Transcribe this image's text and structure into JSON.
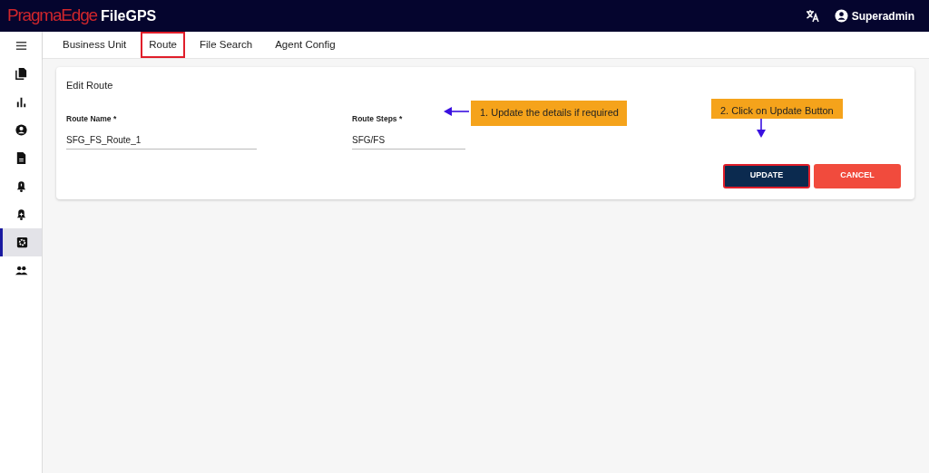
{
  "header": {
    "logo_brand": "PragmaEdge",
    "logo_product": "FileGPS",
    "user": "Superadmin"
  },
  "sidebar": {
    "items": [
      {
        "kind": "menu",
        "selected": false
      },
      {
        "kind": "files",
        "selected": false
      },
      {
        "kind": "chart",
        "selected": false
      },
      {
        "kind": "account",
        "selected": false
      },
      {
        "kind": "document",
        "selected": false
      },
      {
        "kind": "bell",
        "selected": false
      },
      {
        "kind": "bellplus",
        "selected": false
      },
      {
        "kind": "settings",
        "selected": true
      },
      {
        "kind": "people",
        "selected": false
      }
    ]
  },
  "tabs": [
    {
      "label": "Business Unit",
      "highlighted": false
    },
    {
      "label": "Route",
      "highlighted": true
    },
    {
      "label": "File Search",
      "highlighted": false
    },
    {
      "label": "Agent Config",
      "highlighted": false
    }
  ],
  "form": {
    "title": "Edit Route",
    "fields": [
      {
        "label": "Route Name *",
        "value": "SFG_FS_Route_1"
      },
      {
        "label": "Route Steps *",
        "value": "SFG/FS"
      }
    ],
    "buttons": [
      {
        "label": "UPDATE",
        "kind": "primary",
        "highlighted": true
      },
      {
        "label": "CANCEL",
        "kind": "danger",
        "highlighted": false
      }
    ]
  },
  "callouts": [
    {
      "text": "1. Update the details if required",
      "kind": "left"
    },
    {
      "text": "2. Click on Update Button",
      "kind": "down"
    }
  ]
}
